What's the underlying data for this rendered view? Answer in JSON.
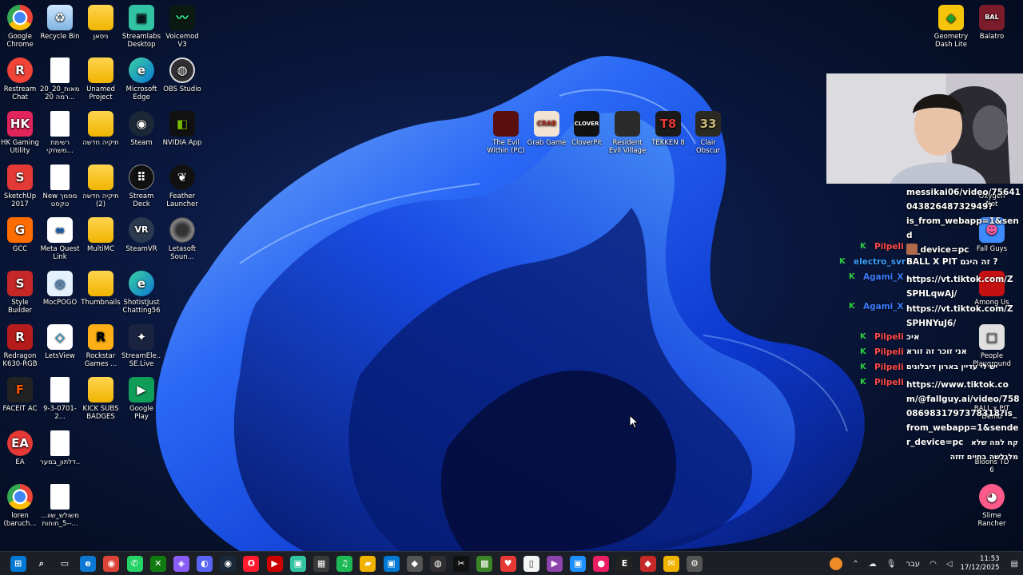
{
  "desktop": {
    "icons_col1": [
      "Google Chrome",
      "Restream Chat",
      "HK Gaming Utility",
      "SketchUp 2017",
      "GCC",
      "Style Builder 2017",
      "Redragon K630-RGB",
      "FACEIT AC",
      "EA",
      "loren (baruch..."
    ],
    "icons_col2": [
      "Recycle Bin",
      "20_דוגמאות_20 רמה 20...",
      "רשימת משחקי...",
      "New מסמך טקסט",
      "Meta Quest Link",
      "MocPOGO",
      "LetsView",
      "9-3-0701-2...",
      "דלתון_במער...",
      "משולש_שוו... -5_חוחות-..."
    ],
    "icons_col3": [
      "ניסאן",
      "Unamed Project So...",
      "תיקיה חדשה",
      "תיקיה חדשה (2)",
      "MultiMC",
      "Thumbnails",
      "Rockstar Games ...",
      "KICK SUBS BADGES"
    ],
    "icons_col4": [
      "Streamlabs Desktop",
      "Microsoft Edge",
      "Steam",
      "Stream Deck",
      "SteamVR",
      "ShotistJust Chatting56",
      "StreamEle... SE.Live",
      "Google Play Games"
    ],
    "icons_col5": [
      "Voicemod V3",
      "OBS Studio",
      "NVIDIA App",
      "Feather Launcher",
      "Letasoft Soun..."
    ],
    "games_row": [
      "The Evil Within (PC)",
      "Grab Game",
      "CloverPit",
      "Resident Evil Village",
      "TEKKEN 8",
      "Clair Obscur Expedition 33"
    ],
    "right_col": [
      "Geometry Dash Lite",
      "Balatro",
      "Oxygen Not Included",
      "Fall Guys",
      "Among Us",
      "People Playground",
      "BALL x PIT Demo",
      "Bloons TD 6",
      "Slime Rancher"
    ]
  },
  "chat": {
    "top_lines": [
      "messikai06/video/75641",
      "04382648732949?",
      "is_from_webapp=1&send",
      "er_device=pc"
    ],
    "messages": [
      {
        "user": "Pilpeli",
        "color": "#ff4a4a",
        "text": ""
      },
      {
        "user": "electro_svr",
        "color": "#3aa0ff",
        "text": "BALL X PIT זה הינם ?"
      },
      {
        "user": "Agami_X",
        "color": "#3a7bff",
        "text": "https://vt.tiktok.com/ZSPHLqwAj/"
      },
      {
        "user": "Agami_X",
        "color": "#3a7bff",
        "text": "https://vt.tiktok.com/ZSPHNYuJ6/"
      },
      {
        "user": "Pilpeli",
        "color": "#ff4a4a",
        "text": "איכ"
      },
      {
        "user": "Pilpeli",
        "color": "#ff4a4a",
        "text": "אני זוכר זה זורא"
      },
      {
        "user": "Pilpeli",
        "color": "#ff4a4a",
        "text": "יש לי עדיין בארון דיבלונים"
      },
      {
        "user": "Pilpeli",
        "color": "#ff4a4a",
        "text": "https://www.tiktok.com/@fallguy.ai/video/7580869831797378318?is_from_webapp=1&sender_device=pc"
      }
    ],
    "tail_lines": [
      "קח למה שלא",
      "מלגלשה בחיים זזזה"
    ]
  },
  "taskbar": {
    "icons": [
      "windows-icon",
      "search-icon",
      "task-view-icon",
      "edge-icon",
      "chrome-icon",
      "whatsapp-icon",
      "xbox-icon",
      "copilot-icon",
      "discord-icon",
      "steam-icon",
      "opera-icon",
      "media-icon",
      "streamlabs-icon",
      "store-icon",
      "spotify-icon",
      "folder-icon",
      "app-icon",
      "shield-icon",
      "obs-icon",
      "capcut-icon",
      "minecraft-icon",
      "heart-icon",
      "file-icon",
      "video-icon",
      "app2-icon",
      "rec-icon",
      "epic-icon",
      "game-icon",
      "mail-icon",
      "settings-icon"
    ],
    "language": "עבר",
    "time": "11:53",
    "date": "17/12/2025"
  }
}
